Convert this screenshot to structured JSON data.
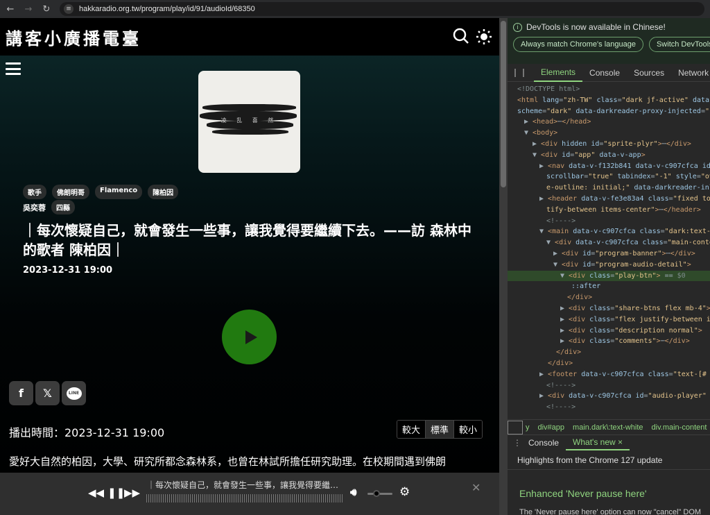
{
  "browser": {
    "url": "hakkaradio.org.tw/program/play/id/91/audioId/68350"
  },
  "site": {
    "logo": "講客小廣播電臺",
    "cover_text": "凌 乱 喜 然",
    "tags_row1": [
      "歌手",
      "佛朗明哥",
      "Flamenco",
      "陳柏因"
    ],
    "author": "吳奕蓉",
    "tags_row2": [
      "四縣"
    ],
    "title": "｜每次懷疑自己，就會發生一些事，讓我覺得要繼續下去。——訪 森林中的歌者 陳柏因｜",
    "date": "2023-12-31 19:00",
    "air_time": "播出時間：2023-12-31 19:00",
    "font_sizes": [
      "較大",
      "標準",
      "較小"
    ],
    "description": "愛好大自然的柏因，大學、研究所都念森林系，也曾在林試所擔任研究助理。在校期間遇到佛朗"
  },
  "player": {
    "title": "｜每次懷疑自己，就會發生一些事，讓我覺得要繼…"
  },
  "devtools": {
    "banner": "DevTools is now available in Chinese!",
    "btn_match": "Always match Chrome's language",
    "btn_switch": "Switch DevTools to Chinese",
    "tabs": [
      "Elements",
      "Console",
      "Sources",
      "Network"
    ],
    "crumbs": [
      "y",
      "div#app",
      "main.dark\\:text-white",
      "div.main-content"
    ],
    "drawer_tabs": [
      "Console",
      "What's new ×"
    ],
    "whats_new_head": "Highlights from the Chrome 127 update",
    "whats_new_title": "Enhanced 'Never pause here'",
    "whats_new_body": "The 'Never pause here' option can now \"cancel\" DOM"
  },
  "colors": {
    "play": "#217a10",
    "devtools_accent": "#8fd47f"
  }
}
